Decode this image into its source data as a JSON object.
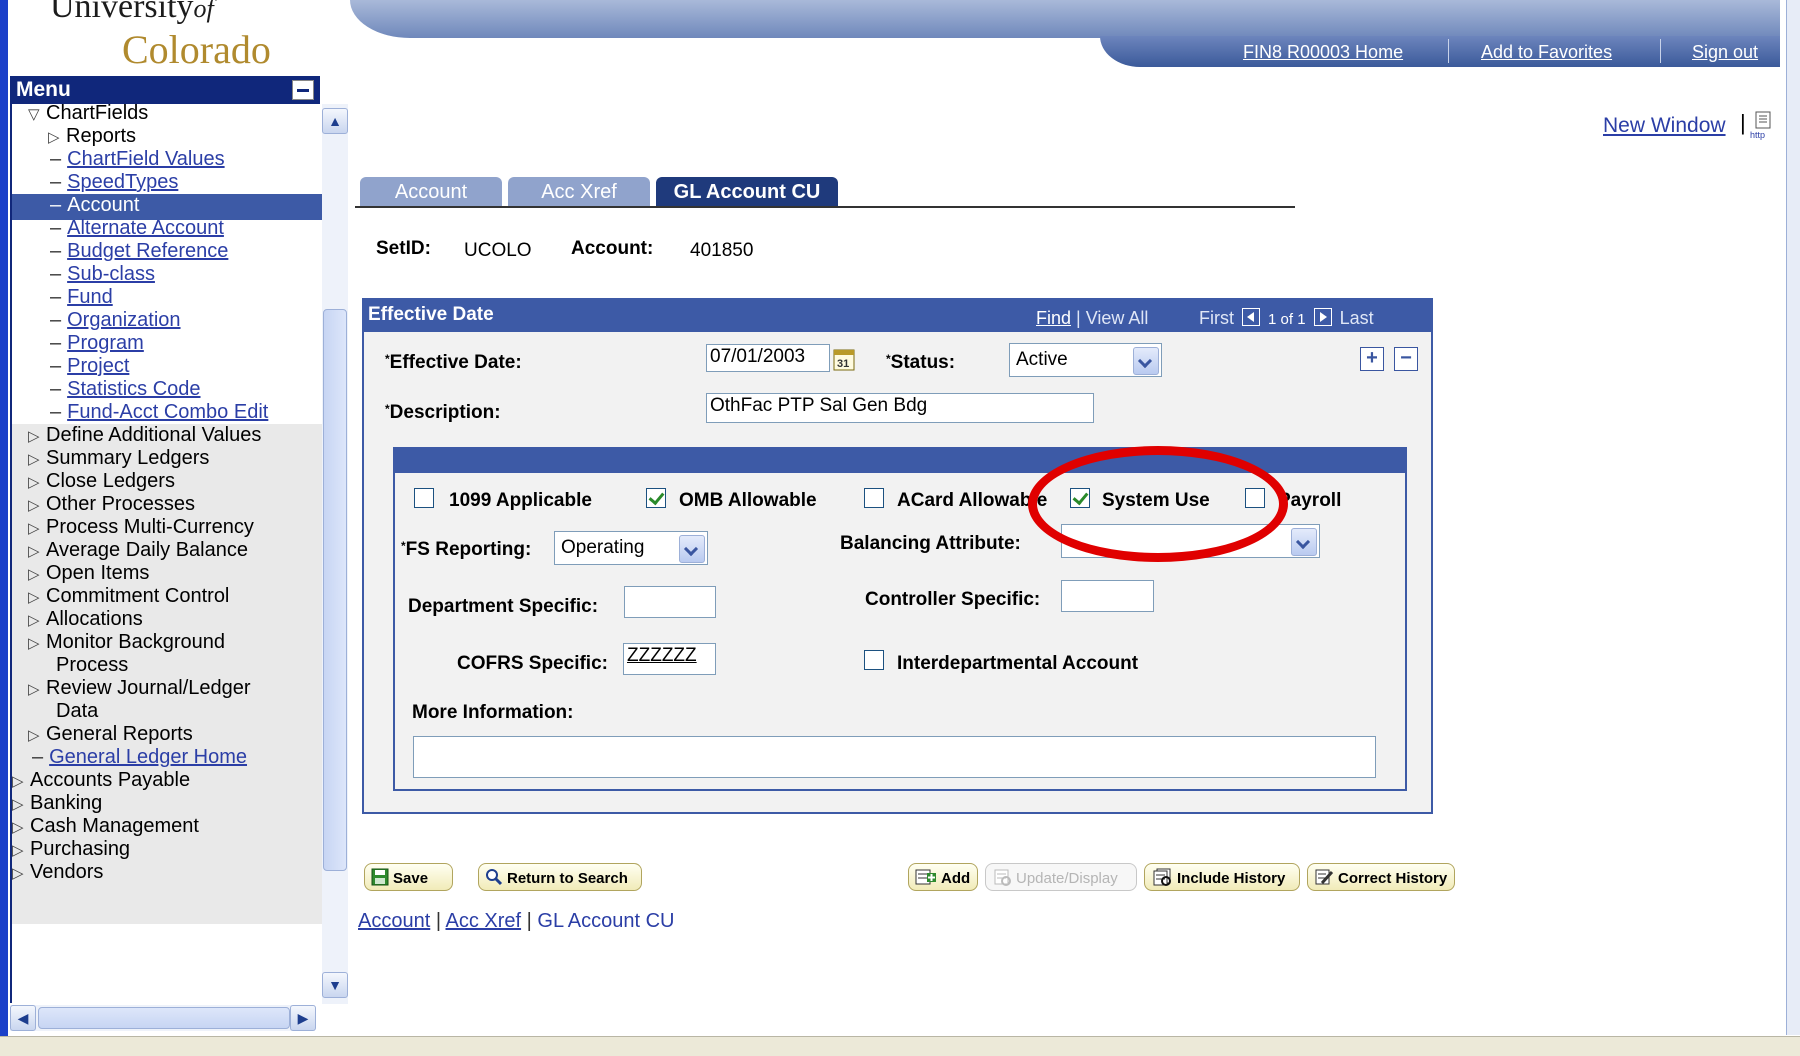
{
  "header": {
    "logo_line1": "University",
    "logo_of": "of",
    "logo_line2": "Colorado",
    "nav": [
      "FIN8 R00003 Home",
      "Add to Favorites",
      "Sign out"
    ]
  },
  "menu": {
    "title": "Menu",
    "items": [
      {
        "label": "ChartFields",
        "kind": "open"
      },
      {
        "label": "Reports",
        "kind": "closed"
      },
      {
        "label": "ChartField Values",
        "kind": "link"
      },
      {
        "label": "SpeedTypes",
        "kind": "link"
      },
      {
        "label": "Account",
        "kind": "selected"
      },
      {
        "label": "Alternate Account",
        "kind": "link"
      },
      {
        "label": "Budget Reference",
        "kind": "link"
      },
      {
        "label": "Sub-class",
        "kind": "link"
      },
      {
        "label": "Fund",
        "kind": "link"
      },
      {
        "label": "Organization",
        "kind": "link"
      },
      {
        "label": "Program",
        "kind": "link"
      },
      {
        "label": "Project",
        "kind": "link"
      },
      {
        "label": "Statistics Code",
        "kind": "link"
      },
      {
        "label": "Fund-Acct Combo Edit",
        "kind": "link"
      },
      {
        "label": "Define Additional Values",
        "kind": "closed"
      },
      {
        "label": "Summary Ledgers",
        "kind": "closed"
      },
      {
        "label": "Close Ledgers",
        "kind": "closed"
      },
      {
        "label": "Other Processes",
        "kind": "closed"
      },
      {
        "label": "Process Multi-Currency",
        "kind": "closed"
      },
      {
        "label": "Average Daily Balance",
        "kind": "closed"
      },
      {
        "label": "Open Items",
        "kind": "closed"
      },
      {
        "label": "Commitment Control",
        "kind": "closed"
      },
      {
        "label": "Allocations",
        "kind": "closed"
      },
      {
        "label": "Monitor Background",
        "kind": "closed"
      },
      {
        "label": "Process",
        "kind": "cont"
      },
      {
        "label": "Review Journal/Ledger",
        "kind": "closed"
      },
      {
        "label": "Data",
        "kind": "cont"
      },
      {
        "label": "General Reports",
        "kind": "closed"
      },
      {
        "label": "General Ledger Home",
        "kind": "link"
      },
      {
        "label": "Accounts Payable",
        "kind": "top"
      },
      {
        "label": "Banking",
        "kind": "top"
      },
      {
        "label": "Cash Management",
        "kind": "top"
      },
      {
        "label": "Purchasing",
        "kind": "top"
      },
      {
        "label": "Vendors",
        "kind": "top"
      }
    ]
  },
  "toplinks": {
    "new_window": "New Window",
    "sep": "|",
    "http_icon_label": "http"
  },
  "tabs": [
    {
      "label": "Account",
      "active": false
    },
    {
      "label": "Acc Xref",
      "active": false
    },
    {
      "label": "GL Account CU",
      "active": true
    }
  ],
  "key": {
    "setid_label": "SetID:",
    "setid_value": "UCOLO",
    "account_label": "Account:",
    "account_value": "401850"
  },
  "effective": {
    "title": "Effective Date",
    "find": "Find",
    "view_all": "View All",
    "first": "First",
    "count": "1 of 1",
    "last": "Last",
    "eff_date_label": "Effective Date:",
    "eff_date_value": "07/01/2003",
    "calendar_day": "31",
    "status_label": "Status:",
    "status_value": "Active",
    "desc_label": "Description:",
    "desc_value": "OthFac PTP Sal Gen Bdg",
    "add_row": "+",
    "delete_row": "−"
  },
  "details": {
    "checkboxes": [
      {
        "label": "1099 Applicable",
        "checked": false
      },
      {
        "label": "OMB Allowable",
        "checked": true
      },
      {
        "label": "ACard Allowable",
        "checked": false
      },
      {
        "label": "System Use",
        "checked": true
      },
      {
        "label": "Payroll",
        "checked": false
      }
    ],
    "fs_reporting_label": "FS Reporting:",
    "fs_reporting_value": "Operating",
    "balancing_label": "Balancing Attribute:",
    "balancing_value": "",
    "dept_specific_label": "Department Specific:",
    "dept_specific_value": "",
    "controller_specific_label": "Controller Specific:",
    "controller_specific_value": "",
    "cofrs_label": "COFRS Specific:",
    "cofrs_value": "ZZZZZZ",
    "interdept_label": "Interdepartmental Account",
    "interdept_checked": false,
    "more_info_label": "More Information:",
    "more_info_value": ""
  },
  "buttons": {
    "save": "Save",
    "return_to_search": "Return to Search",
    "add": "Add",
    "update_display": "Update/Display",
    "include_history": "Include History",
    "correct_history": "Correct History"
  },
  "bottom_links": [
    "Account",
    "Acc Xref",
    "GL Account CU"
  ],
  "bottom_sep": "|",
  "highlight": {
    "color": "#e00000"
  }
}
